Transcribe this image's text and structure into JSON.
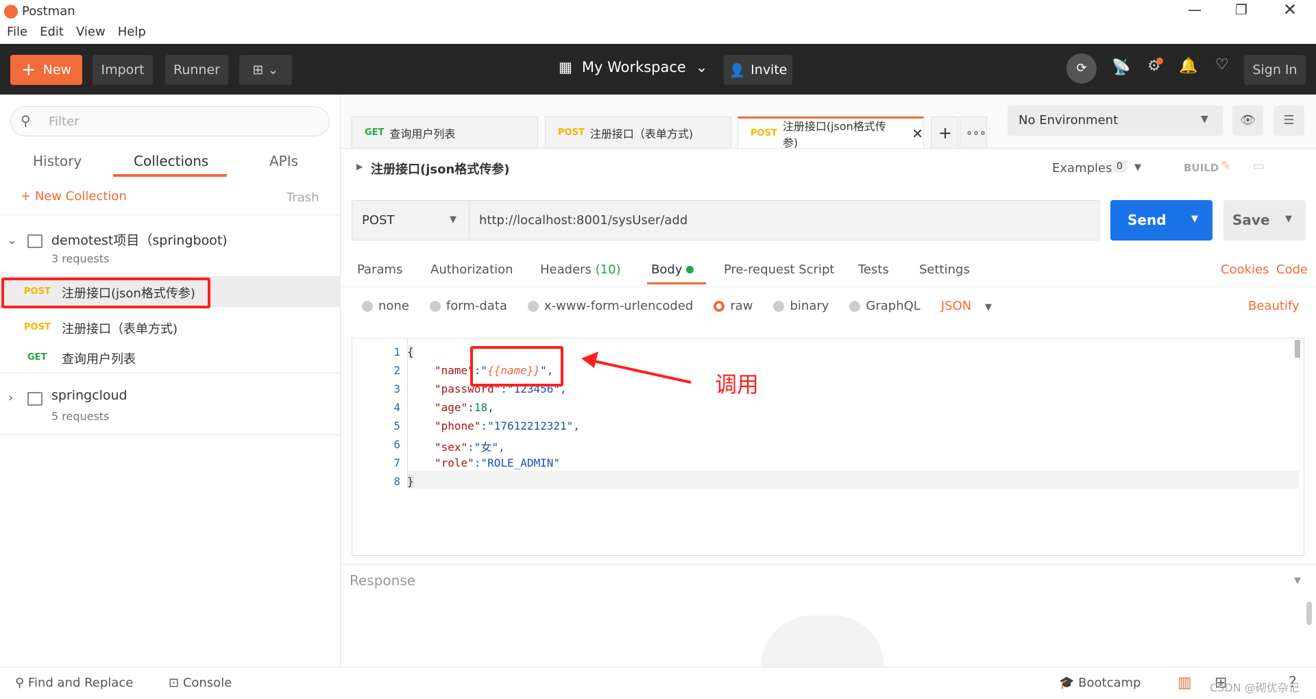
{
  "window": {
    "title": "Postman"
  },
  "menu": [
    "File",
    "Edit",
    "View",
    "Help"
  ],
  "toolbar": {
    "new": "New",
    "import": "Import",
    "runner": "Runner",
    "workspace": "My Workspace",
    "invite": "Invite",
    "sign_in": "Sign In"
  },
  "sidebar": {
    "filter_placeholder": "Filter",
    "tabs": [
      "History",
      "Collections",
      "APIs"
    ],
    "new_collection": "New Collection",
    "trash": "Trash",
    "collections": [
      {
        "name": "demotest项目（springboot)",
        "count": "3 requests",
        "requests": [
          {
            "method": "POST",
            "name": "注册接口(json格式传参)"
          },
          {
            "method": "POST",
            "name": "注册接口（表单方式)"
          },
          {
            "method": "GET",
            "name": "查询用户列表"
          }
        ]
      },
      {
        "name": "springcloud",
        "count": "5 requests"
      }
    ]
  },
  "tabs": [
    {
      "method": "GET",
      "name": "查询用户列表"
    },
    {
      "method": "POST",
      "name": "注册接口（表单方式)"
    },
    {
      "method": "POST",
      "name": "注册接口(json格式传参)"
    }
  ],
  "environment": "No Environment",
  "request": {
    "name": "注册接口(json格式传参)",
    "examples_label": "Examples",
    "examples_count": "0",
    "build": "BUILD",
    "method": "POST",
    "url": "http://localhost:8001/sysUser/add",
    "send": "Send",
    "save": "Save"
  },
  "subtabs": [
    "Params",
    "Authorization",
    "Headers",
    "(10)",
    "Body",
    "Pre-request Script",
    "Tests",
    "Settings"
  ],
  "links": {
    "cookies": "Cookies",
    "code": "Code",
    "beautify": "Beautify"
  },
  "body_types": [
    "none",
    "form-data",
    "x-www-form-urlencoded",
    "raw",
    "binary",
    "GraphQL"
  ],
  "body_format": "JSON",
  "code_lines": [
    "{",
    "\"name\"",
    ":\"",
    "{{name}}",
    "\",",
    "\"password\"",
    ":\"123456\",",
    "\"age\"",
    ":",
    "18",
    ",",
    "\"phone\"",
    ":\"17612212321\",",
    "\"sex\"",
    ":\"女\",",
    "\"role\"",
    ":\"ROLE_ADMIN\"",
    "}"
  ],
  "annotation": "调用",
  "response": {
    "label": "Response"
  },
  "bottom": {
    "find_replace": "Find and Replace",
    "console": "Console",
    "bootcamp": "Bootcamp",
    "watermark": "CSDN @砌优杂记"
  },
  "colors": {
    "accent": "#f26b3a",
    "send": "#1a73e8",
    "annotation": "#ff2020"
  }
}
